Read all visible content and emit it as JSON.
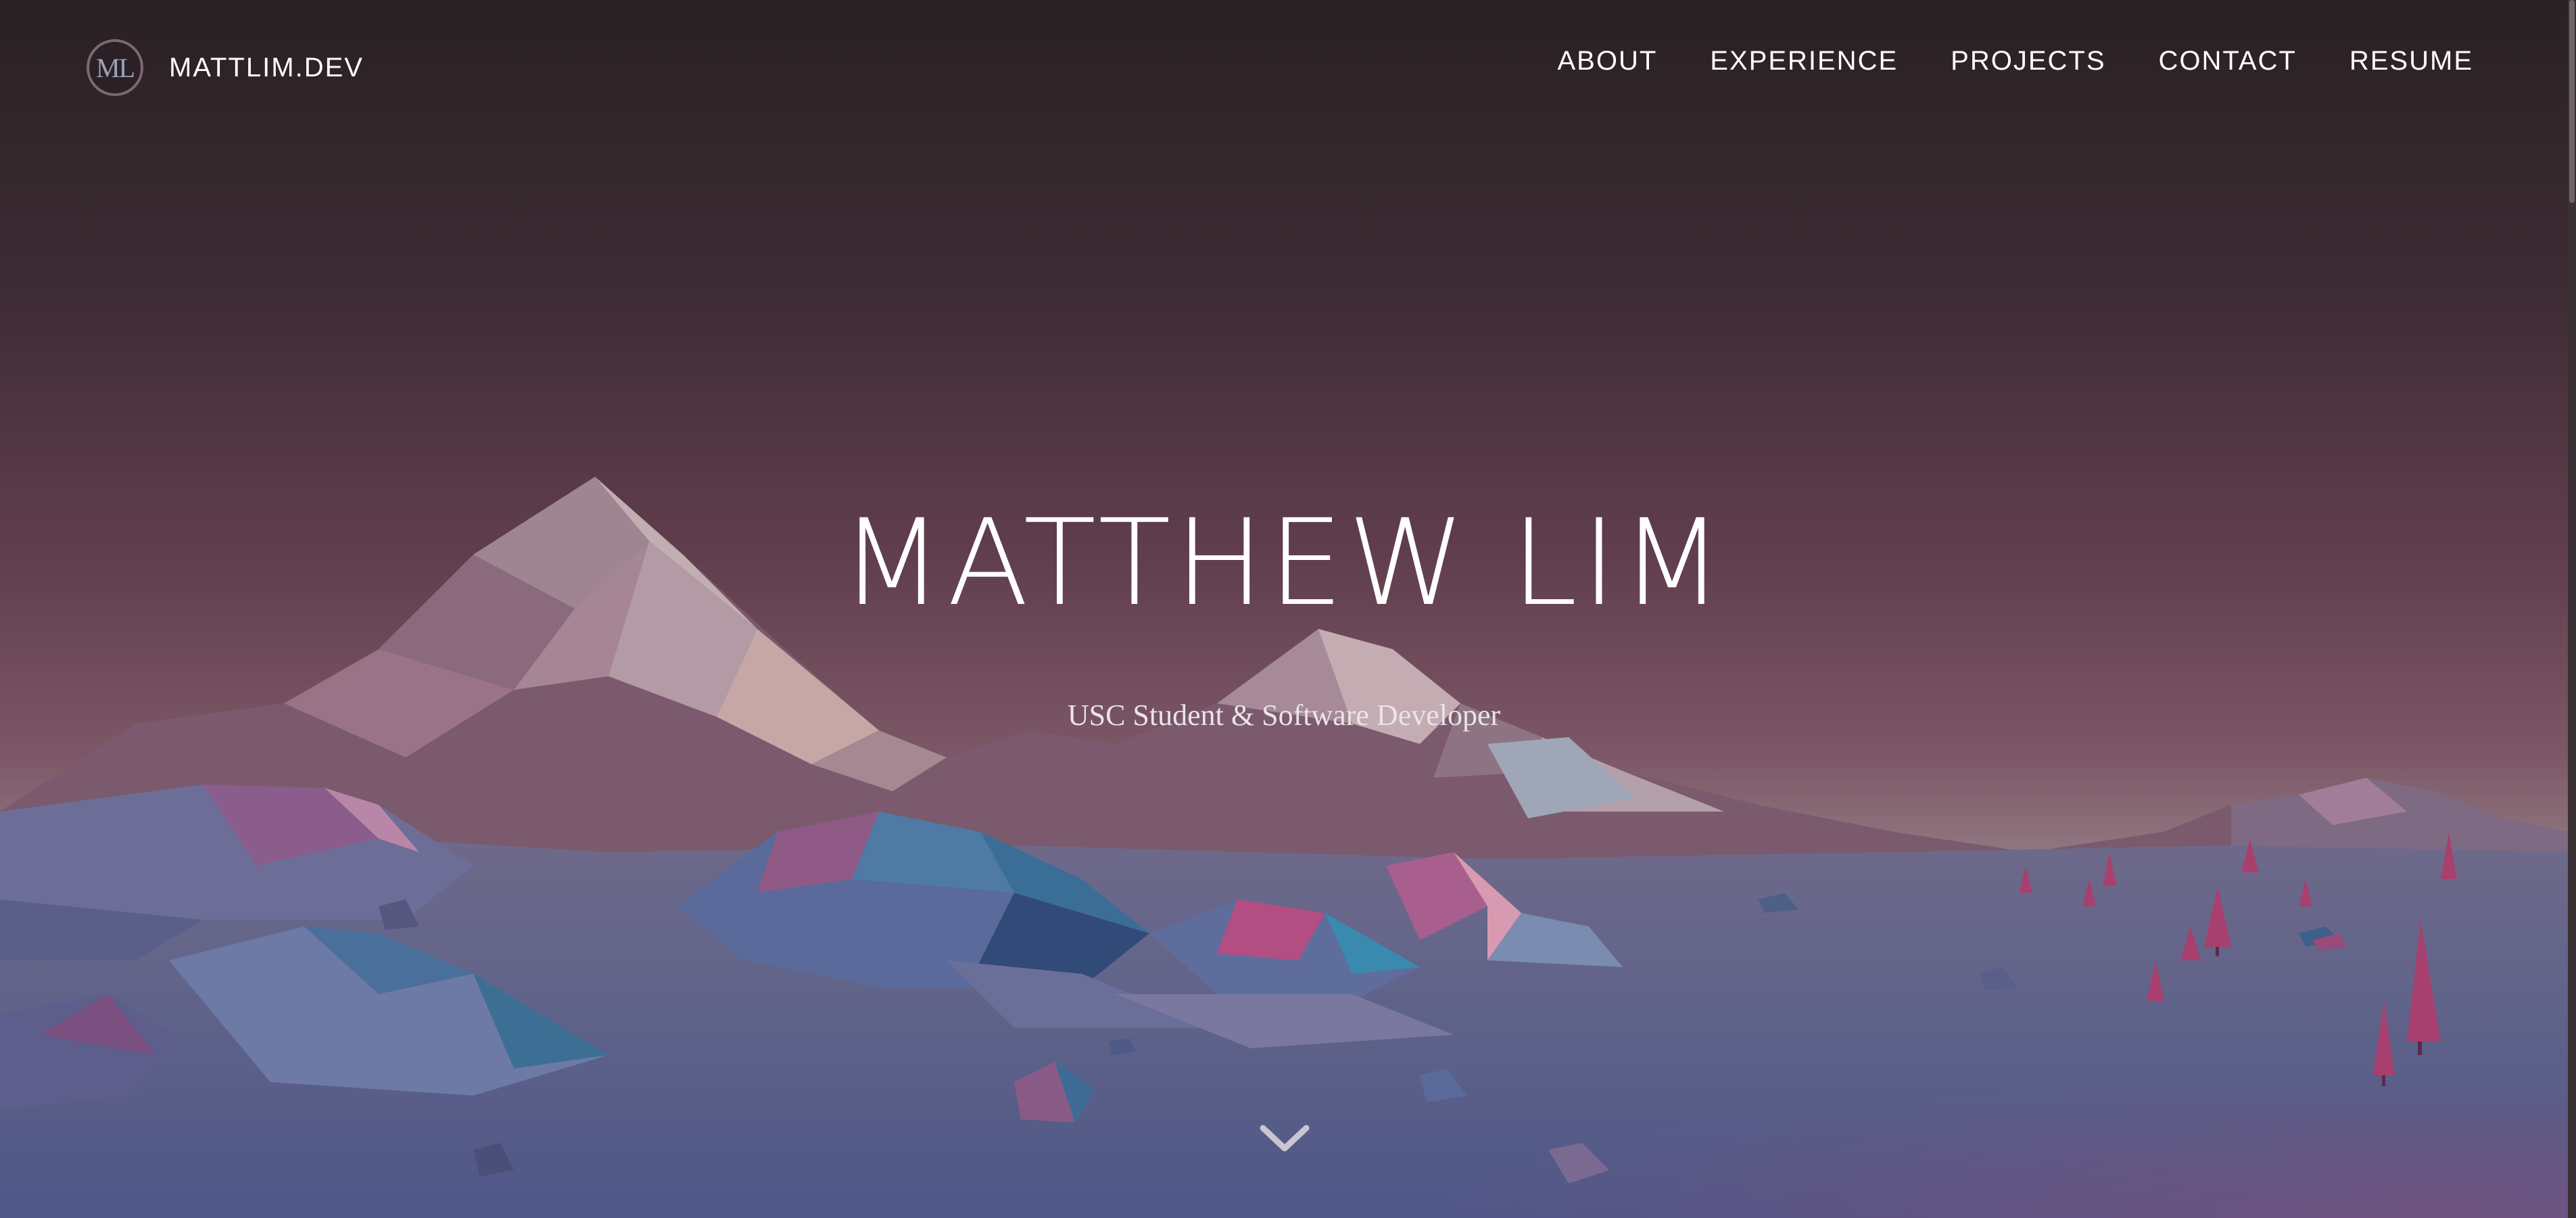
{
  "navbar": {
    "brand_monogram": "ML",
    "brand_name": "MATTLIM.DEV",
    "links": [
      {
        "label": "ABOUT"
      },
      {
        "label": "EXPERIENCE"
      },
      {
        "label": "PROJECTS"
      },
      {
        "label": "CONTACT"
      },
      {
        "label": "RESUME"
      }
    ]
  },
  "hero": {
    "title": "MATTHEW LIM",
    "subtitle": "USC Student & Software Developer",
    "scroll_icon": "chevron-down-icon",
    "background": "low-poly mountain landscape"
  },
  "colors": {
    "sky_top": "#30272a",
    "sky_mid": "#5a3a48",
    "horizon": "#8f6b78",
    "ground": "#5a5f8a",
    "text": "#ffffff"
  }
}
